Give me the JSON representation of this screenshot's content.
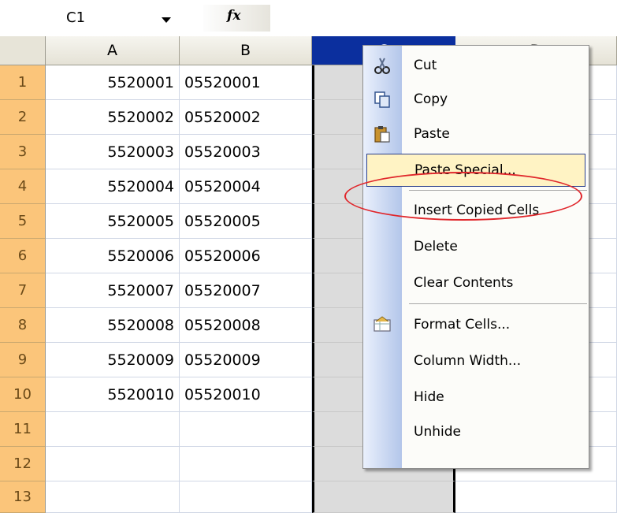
{
  "name_box": {
    "value": "C1"
  },
  "formula_bar": {
    "fx_label": "fx"
  },
  "columns": [
    "A",
    "B",
    "C",
    "D"
  ],
  "selected_column": "C",
  "rows": [
    {
      "n": "1",
      "a": "5520001",
      "b": "05520001"
    },
    {
      "n": "2",
      "a": "5520002",
      "b": "05520002"
    },
    {
      "n": "3",
      "a": "5520003",
      "b": "05520003"
    },
    {
      "n": "4",
      "a": "5520004",
      "b": "05520004"
    },
    {
      "n": "5",
      "a": "5520005",
      "b": "05520005"
    },
    {
      "n": "6",
      "a": "5520006",
      "b": "05520006"
    },
    {
      "n": "7",
      "a": "5520007",
      "b": "05520007"
    },
    {
      "n": "8",
      "a": "5520008",
      "b": "05520008"
    },
    {
      "n": "9",
      "a": "5520009",
      "b": "05520009"
    },
    {
      "n": "10",
      "a": "5520010",
      "b": "05520010"
    },
    {
      "n": "11",
      "a": "",
      "b": ""
    },
    {
      "n": "12",
      "a": "",
      "b": ""
    },
    {
      "n": "13",
      "a": "",
      "b": ""
    }
  ],
  "context_menu": {
    "items": [
      {
        "label": "Cut",
        "icon": "scissors-icon"
      },
      {
        "label": "Copy",
        "icon": "copy-icon"
      },
      {
        "label": "Paste",
        "icon": "paste-icon"
      },
      {
        "label": "Paste Special...",
        "highlighted": true
      },
      {
        "label": "Insert Copied Cells"
      },
      {
        "label": "Delete"
      },
      {
        "label": "Clear Contents"
      },
      {
        "label": "Format Cells...",
        "icon": "format-cells-icon"
      },
      {
        "label": "Column Width..."
      },
      {
        "label": "Hide"
      },
      {
        "label": "Unhide"
      }
    ]
  },
  "colors": {
    "selected_header": "#0b2f9e",
    "row_header": "#fbc57a",
    "highlight_ring": "#e0262b",
    "menu_highlight": "#fff3c4"
  }
}
